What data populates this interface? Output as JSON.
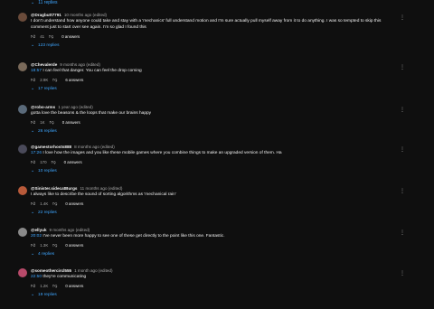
{
  "top_link": {
    "label": "11 replies",
    "icon": "chevron-down-icon"
  },
  "comments": [
    {
      "author": "@Dragbutt7791",
      "time": "10 months ago (edited)",
      "avatar_color": "#6a4b3a",
      "text": "I don't understand how anyone could take and stay with a 'mechanics' full understand motion and I'm sure actually pull myself away from it to do anything. I was so tempted to skip this",
      "text2": "comment just to start over see again. I'm so glad I found this",
      "likes": "41",
      "replies_label": "123 replies",
      "reply_label": "0 answers"
    },
    {
      "author": "@Chevalerde",
      "time": "9 months ago (edited)",
      "avatar_color": "#7a6a5a",
      "ts": "18:57",
      "text": "I can feel that danger. You can feel the drop coming",
      "likes": "2.9K",
      "replies_label": "17 replies",
      "reply_label": "6 answers"
    },
    {
      "author": "@robo-arms",
      "time": "1 year ago (edited)",
      "avatar_color": "#5a6a7a",
      "text": "gotta love the beasons & the loops that make our brains happy",
      "likes": "1K",
      "replies_label": "26 replies",
      "reply_label": "0 answers"
    },
    {
      "author": "@gamestorhosts888",
      "time": "8 months ago (edited)",
      "avatar_color": "#4a4a5a",
      "ts": "17:26",
      "text": "I love how the images and you like these mobile games where you combine things to make an upgraded version of them. Ha",
      "likes": "170",
      "replies_label": "10 replies",
      "reply_label": "0 answers"
    },
    {
      "author": "@Sinister.sidecatBurgs",
      "time": "11 months ago (edited)",
      "avatar_color": "#b85a3a",
      "text": "I always like to describe the sound of sorting algorithms as 'mechanical rain'",
      "likes": "1.4K",
      "replies_label": "22 replies",
      "reply_label": "0 answers"
    },
    {
      "author": "@ellyuk",
      "time": "9 months ago (edited)",
      "avatar_color": "#8a8a8a",
      "ts": "20:02",
      "text": "I've never been more happy to see one of these get directly to the point like this one. Fantastic.",
      "likes": "1.3K",
      "replies_label": "4 replies",
      "reply_label": "0 answers"
    },
    {
      "author": "@someothercircl555",
      "time": "1 month ago (edited)",
      "avatar_color": "#b84a6a",
      "ts": "22:50",
      "text": "they're communicating",
      "likes": "1.2K",
      "replies_label": "19 replies",
      "reply_label": "0 answers"
    }
  ],
  "icons": {
    "like": "thumbs-up-icon",
    "dislike": "thumbs-down-icon",
    "more": "more-vertical-icon"
  },
  "colors": {
    "link": "#3ea6ff",
    "bg": "#0f0f0f",
    "text": "#f1f1f1",
    "muted": "#aaaaaa"
  }
}
